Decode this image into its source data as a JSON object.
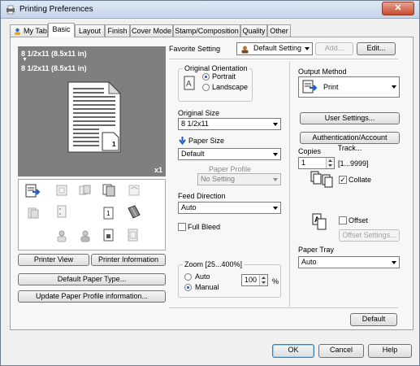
{
  "window": {
    "title": "Printing Preferences",
    "close_glyph": "✕"
  },
  "tabs": [
    {
      "label": "My Tab",
      "active": false
    },
    {
      "label": "Basic",
      "active": true
    },
    {
      "label": "Layout",
      "active": false
    },
    {
      "label": "Finish",
      "active": false
    },
    {
      "label": "Cover Mode",
      "active": false
    },
    {
      "label": "Stamp/Composition",
      "active": false
    },
    {
      "label": "Quality",
      "active": false
    },
    {
      "label": "Other",
      "active": false
    }
  ],
  "preview": {
    "line1": "8 1/2x11 (8.5x11 in)",
    "arrow": "▼",
    "line2": "8 1/2x11 (8.5x11 in)",
    "page_number": "1",
    "copies_badge": "x1"
  },
  "left_buttons": {
    "printer_view": "Printer View",
    "printer_information": "Printer Information",
    "default_paper_type": "Default Paper Type...",
    "update_paper_profile": "Update Paper Profile information..."
  },
  "favorite": {
    "label": "Favorite Setting",
    "value": "Default Setting",
    "add": "Add...",
    "edit": "Edit..."
  },
  "orientation": {
    "label": "Original Orientation",
    "portrait": "Portrait",
    "landscape": "Landscape",
    "selected": "Portrait"
  },
  "original_size": {
    "label": "Original Size",
    "value": "8 1/2x11"
  },
  "paper_size": {
    "label": "Paper Size",
    "value": "Default"
  },
  "paper_profile": {
    "label": "Paper Profile",
    "value": "No Setting"
  },
  "feed_direction": {
    "label": "Feed Direction",
    "value": "Auto"
  },
  "full_bleed": {
    "label": "Full Bleed",
    "checked": false
  },
  "zoom": {
    "label": "Zoom [25...400%]",
    "auto": "Auto",
    "manual": "Manual",
    "selected": "Manual",
    "value": "100",
    "unit": "%"
  },
  "output_method": {
    "label": "Output Method",
    "value": "Print"
  },
  "right_buttons": {
    "user_settings": "User Settings...",
    "authentication": "Authentication/Account Track..."
  },
  "copies": {
    "label": "Copies",
    "value": "1",
    "range": "[1...9999]",
    "collate_label": "Collate",
    "collate_checked": true
  },
  "offset": {
    "label": "Offset",
    "checked": false,
    "settings": "Offset Settings..."
  },
  "paper_tray": {
    "label": "Paper Tray",
    "value": "Auto"
  },
  "panel_default": "Default",
  "footer": {
    "ok": "OK",
    "cancel": "Cancel",
    "help": "Help"
  },
  "colors": {
    "preview_bg": "#7f7f7f",
    "accent_blue": "#1e5bc6",
    "close_red": "#c74a2d"
  }
}
